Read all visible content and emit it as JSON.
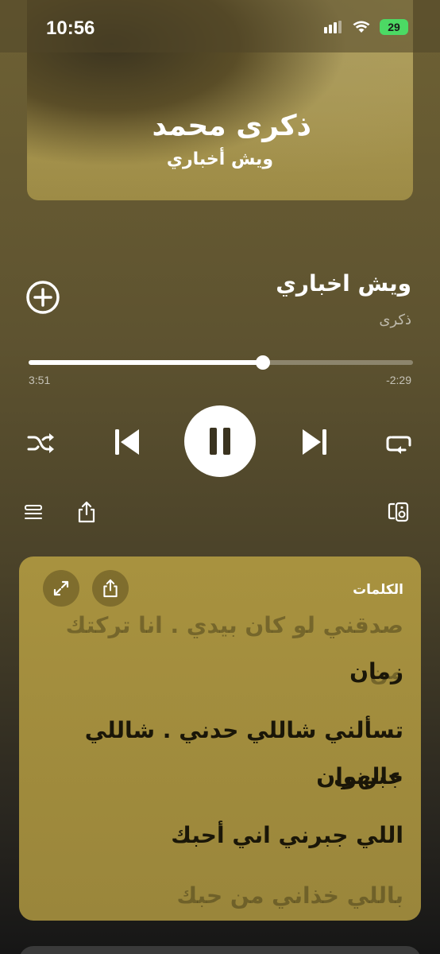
{
  "status_bar": {
    "time": "10:56",
    "battery": "29"
  },
  "artwork": {
    "artist_text": "ذكرى محمد",
    "song_text": "ويش أخباري"
  },
  "now_playing": {
    "title": "ويش اخباري",
    "artist": "ذكرى"
  },
  "playback": {
    "elapsed": "3:51",
    "remaining": "-2:29",
    "progress_fraction": 0.61
  },
  "lyrics": {
    "label": "الكلمات",
    "faded_top": "صدقني لو كان بيدي . انا تركتك من",
    "lines": [
      "زمان",
      "تسألني شاللي حدني . شاللي جبرني",
      "عالهوان",
      "اللي جبرني اني أحبك"
    ],
    "faded_bottom": "باللي خذاني من حبك"
  },
  "icons": {
    "add": "plus-circle-icon",
    "shuffle": "shuffle-icon",
    "previous": "previous-icon",
    "pause": "pause-icon",
    "next": "next-icon",
    "repeat": "repeat-icon",
    "queue": "queue-list-icon",
    "share": "share-icon",
    "remote": "remote-icon",
    "expand": "expand-icon"
  },
  "colors": {
    "battery": "#4cd964",
    "lyrics_card": "#a8923f"
  }
}
